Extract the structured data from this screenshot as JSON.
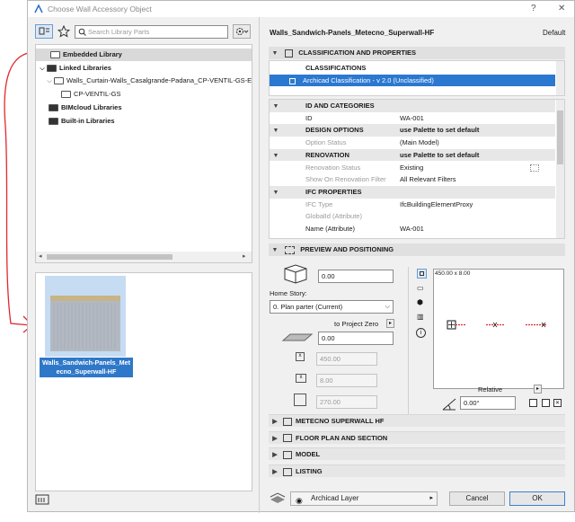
{
  "window": {
    "title": "Choose Wall Accessory Object",
    "help": "?",
    "close": "✕"
  },
  "search": {
    "placeholder": "Search Library Parts"
  },
  "tree": [
    {
      "label": "Embedded Library",
      "bold": true,
      "selected": true
    },
    {
      "label": "Linked Libraries",
      "bold": true
    },
    {
      "label": "Walls_Curtain-Walls_Casalgrande-Padana_CP-VENTIL-GS-E"
    },
    {
      "label": "CP-VENTIL-GS"
    },
    {
      "label": "BIMcloud Libraries",
      "bold": true
    },
    {
      "label": "Built-in Libraries",
      "bold": true
    }
  ],
  "thumb": {
    "caption_line1": "Walls_Sandwich-Panels_Met",
    "caption_line2": "ecno_Superwall-HF"
  },
  "object_name": "Walls_Sandwich-Panels_Metecno_Superwall-HF",
  "default_label": "Default",
  "classification": {
    "header": "CLASSIFICATION AND PROPERTIES",
    "col_header": "CLASSIFICATIONS",
    "selected_row": "Archicad Classification - v 2.0 (Unclassified)"
  },
  "props": [
    {
      "type": "hdr",
      "name": "ID AND CATEGORIES"
    },
    {
      "name": "ID",
      "value": "WA-001"
    },
    {
      "type": "hdr2",
      "name": "DESIGN OPTIONS",
      "value": "use Palette to set default"
    },
    {
      "name": "Option Status",
      "value": "(Main Model)",
      "grey": true
    },
    {
      "type": "hdr2",
      "name": "RENOVATION",
      "value": "use Palette to set default"
    },
    {
      "name": "Renovation Status",
      "value": "Existing",
      "grey": true
    },
    {
      "name": "Show On Renovation Filter",
      "value": "All Relevant Filters",
      "grey": true
    },
    {
      "type": "hdr",
      "name": "IFC PROPERTIES"
    },
    {
      "name": "IFC Type",
      "value": "IfcBuildingElementProxy",
      "grey": true
    },
    {
      "name": "GlobalId (Attribute)",
      "value": "",
      "grey": true
    },
    {
      "name": "Name (Attribute)",
      "value": "WA-001"
    }
  ],
  "preview": {
    "header": "PREVIEW AND POSITIONING",
    "elevation": "0.00",
    "home_story_label": "Home Story:",
    "home_story_value": "0. Plan parter (Current)",
    "to_project_zero": "to Project Zero",
    "offset": "0.00",
    "width": "450.00",
    "length": "8.00",
    "height": "270.00",
    "preview_caption": "450.00 x 8.00",
    "relative_label": "Relative",
    "angle": "0.00°"
  },
  "sections": [
    "METECNO SUPERWALL HF",
    "FLOOR PLAN AND SECTION",
    "MODEL",
    "LISTING"
  ],
  "footer": {
    "layer": "Archicad Layer",
    "cancel": "Cancel",
    "ok": "OK"
  }
}
